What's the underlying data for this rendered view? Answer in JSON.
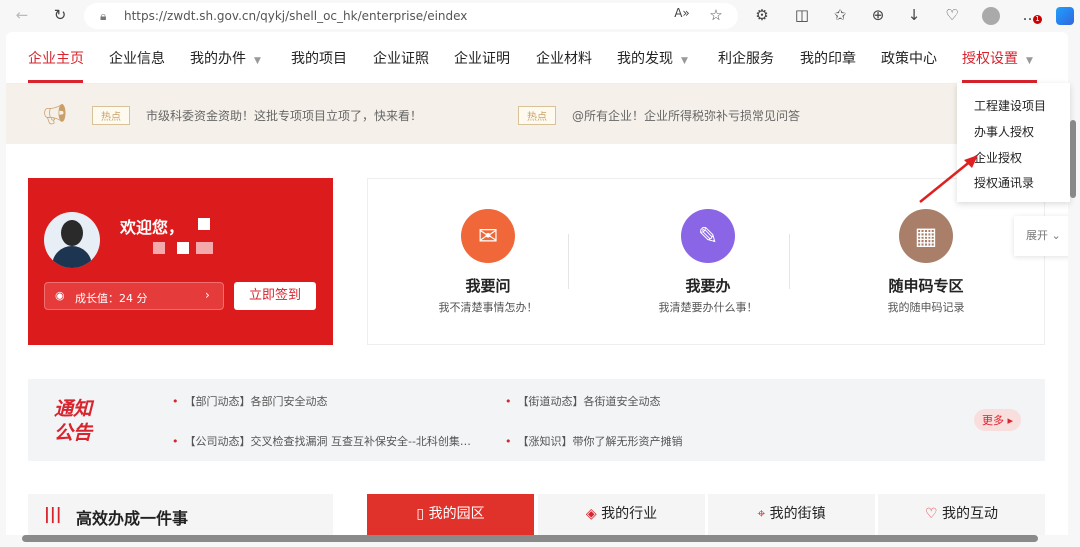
{
  "browser": {
    "url": "https://zwdt.sh.gov.cn/qykj/shell_oc_hk/enterprise/eindex",
    "badge": "1"
  },
  "nav": {
    "items": [
      "企业主页",
      "企业信息",
      "我的办件",
      "我的项目",
      "企业证照",
      "企业证明",
      "企业材料",
      "我的发现",
      "利企服务",
      "我的印章",
      "政策中心",
      "授权设置"
    ]
  },
  "dropdown": {
    "items": [
      "工程建设项目",
      "办事人授权",
      "企业授权",
      "授权通讯录"
    ]
  },
  "notice": {
    "tag": "热点",
    "items": [
      "市级科委资金资助！这批专项项目立项了，快来看！",
      "@所有企业！企业所得税弥补亏损常见问答"
    ]
  },
  "welcome": {
    "greeting": "欢迎您，",
    "growth": "成长值：24 分",
    "checkin": "立即签到"
  },
  "services": [
    {
      "title": "我要问",
      "sub": "我不清楚事情怎办！"
    },
    {
      "title": "我要办",
      "sub": "我清楚要办什么事！"
    },
    {
      "title": "随申码专区",
      "sub": "我的随申码记录"
    }
  ],
  "expand": "展开",
  "notif": {
    "title1": "通知",
    "title2": "公告",
    "items": [
      "【部门动态】各部门安全动态",
      "【街道动态】各街道安全动态",
      "【公司动态】交叉检查找漏洞 互查互补保安全--北科创集…",
      "【涨知识】带你了解无形资产摊销"
    ],
    "more": "更多"
  },
  "bottom": {
    "heading": "高效办成一件事",
    "tabs": [
      "我的园区",
      "我的行业",
      "我的街镇",
      "我的互动"
    ]
  },
  "colors": {
    "accent": "#d9232d"
  }
}
